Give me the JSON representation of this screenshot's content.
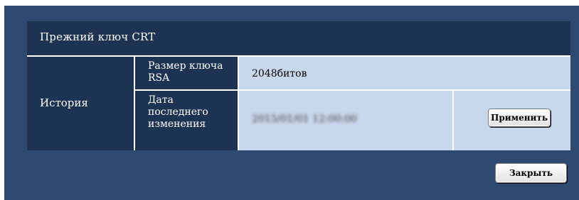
{
  "header": {
    "title": "Прежний ключ CRT"
  },
  "history": {
    "label": "История",
    "rsa_key_size": {
      "label_line1": "Размер ключа",
      "label_line2": "RSA",
      "value": "2048битов"
    },
    "last_modified": {
      "label_line1": "Дата",
      "label_line2": "последнего",
      "label_line3": "изменения",
      "value": "2015/01/01 12:00:00"
    },
    "apply_button": "Применить"
  },
  "footer": {
    "close_button": "Закрыть"
  }
}
